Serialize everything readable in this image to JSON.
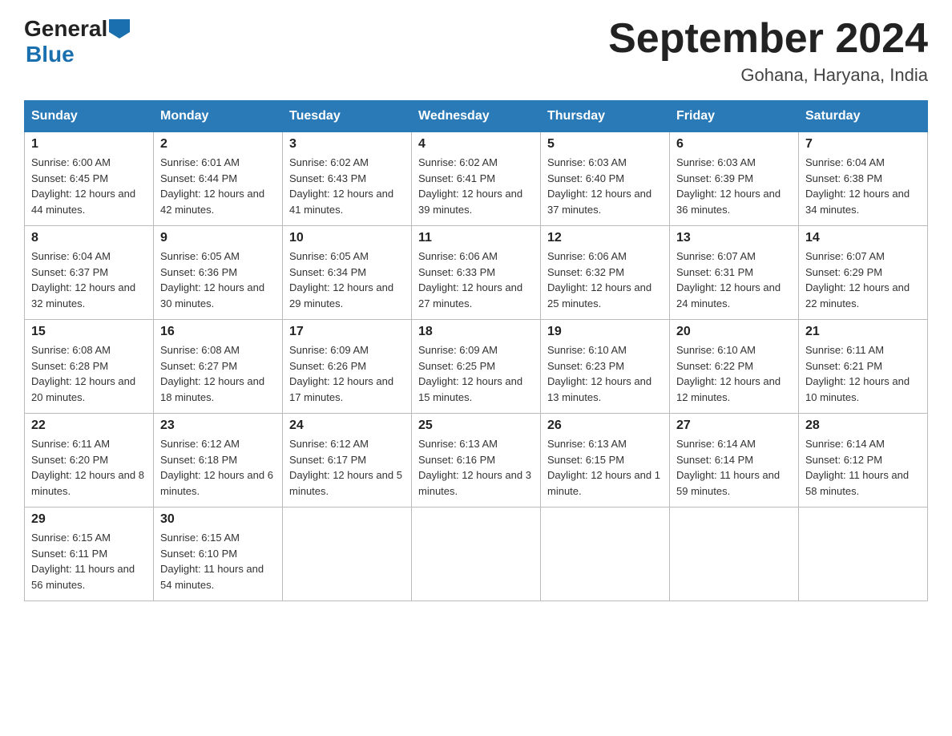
{
  "header": {
    "logo_general": "General",
    "logo_blue": "Blue",
    "month_title": "September 2024",
    "location": "Gohana, Haryana, India"
  },
  "days_of_week": [
    "Sunday",
    "Monday",
    "Tuesday",
    "Wednesday",
    "Thursday",
    "Friday",
    "Saturday"
  ],
  "weeks": [
    [
      {
        "day": "1",
        "sunrise": "6:00 AM",
        "sunset": "6:45 PM",
        "daylight": "12 hours and 44 minutes."
      },
      {
        "day": "2",
        "sunrise": "6:01 AM",
        "sunset": "6:44 PM",
        "daylight": "12 hours and 42 minutes."
      },
      {
        "day": "3",
        "sunrise": "6:02 AM",
        "sunset": "6:43 PM",
        "daylight": "12 hours and 41 minutes."
      },
      {
        "day": "4",
        "sunrise": "6:02 AM",
        "sunset": "6:41 PM",
        "daylight": "12 hours and 39 minutes."
      },
      {
        "day": "5",
        "sunrise": "6:03 AM",
        "sunset": "6:40 PM",
        "daylight": "12 hours and 37 minutes."
      },
      {
        "day": "6",
        "sunrise": "6:03 AM",
        "sunset": "6:39 PM",
        "daylight": "12 hours and 36 minutes."
      },
      {
        "day": "7",
        "sunrise": "6:04 AM",
        "sunset": "6:38 PM",
        "daylight": "12 hours and 34 minutes."
      }
    ],
    [
      {
        "day": "8",
        "sunrise": "6:04 AM",
        "sunset": "6:37 PM",
        "daylight": "12 hours and 32 minutes."
      },
      {
        "day": "9",
        "sunrise": "6:05 AM",
        "sunset": "6:36 PM",
        "daylight": "12 hours and 30 minutes."
      },
      {
        "day": "10",
        "sunrise": "6:05 AM",
        "sunset": "6:34 PM",
        "daylight": "12 hours and 29 minutes."
      },
      {
        "day": "11",
        "sunrise": "6:06 AM",
        "sunset": "6:33 PM",
        "daylight": "12 hours and 27 minutes."
      },
      {
        "day": "12",
        "sunrise": "6:06 AM",
        "sunset": "6:32 PM",
        "daylight": "12 hours and 25 minutes."
      },
      {
        "day": "13",
        "sunrise": "6:07 AM",
        "sunset": "6:31 PM",
        "daylight": "12 hours and 24 minutes."
      },
      {
        "day": "14",
        "sunrise": "6:07 AM",
        "sunset": "6:29 PM",
        "daylight": "12 hours and 22 minutes."
      }
    ],
    [
      {
        "day": "15",
        "sunrise": "6:08 AM",
        "sunset": "6:28 PM",
        "daylight": "12 hours and 20 minutes."
      },
      {
        "day": "16",
        "sunrise": "6:08 AM",
        "sunset": "6:27 PM",
        "daylight": "12 hours and 18 minutes."
      },
      {
        "day": "17",
        "sunrise": "6:09 AM",
        "sunset": "6:26 PM",
        "daylight": "12 hours and 17 minutes."
      },
      {
        "day": "18",
        "sunrise": "6:09 AM",
        "sunset": "6:25 PM",
        "daylight": "12 hours and 15 minutes."
      },
      {
        "day": "19",
        "sunrise": "6:10 AM",
        "sunset": "6:23 PM",
        "daylight": "12 hours and 13 minutes."
      },
      {
        "day": "20",
        "sunrise": "6:10 AM",
        "sunset": "6:22 PM",
        "daylight": "12 hours and 12 minutes."
      },
      {
        "day": "21",
        "sunrise": "6:11 AM",
        "sunset": "6:21 PM",
        "daylight": "12 hours and 10 minutes."
      }
    ],
    [
      {
        "day": "22",
        "sunrise": "6:11 AM",
        "sunset": "6:20 PM",
        "daylight": "12 hours and 8 minutes."
      },
      {
        "day": "23",
        "sunrise": "6:12 AM",
        "sunset": "6:18 PM",
        "daylight": "12 hours and 6 minutes."
      },
      {
        "day": "24",
        "sunrise": "6:12 AM",
        "sunset": "6:17 PM",
        "daylight": "12 hours and 5 minutes."
      },
      {
        "day": "25",
        "sunrise": "6:13 AM",
        "sunset": "6:16 PM",
        "daylight": "12 hours and 3 minutes."
      },
      {
        "day": "26",
        "sunrise": "6:13 AM",
        "sunset": "6:15 PM",
        "daylight": "12 hours and 1 minute."
      },
      {
        "day": "27",
        "sunrise": "6:14 AM",
        "sunset": "6:14 PM",
        "daylight": "11 hours and 59 minutes."
      },
      {
        "day": "28",
        "sunrise": "6:14 AM",
        "sunset": "6:12 PM",
        "daylight": "11 hours and 58 minutes."
      }
    ],
    [
      {
        "day": "29",
        "sunrise": "6:15 AM",
        "sunset": "6:11 PM",
        "daylight": "11 hours and 56 minutes."
      },
      {
        "day": "30",
        "sunrise": "6:15 AM",
        "sunset": "6:10 PM",
        "daylight": "11 hours and 54 minutes."
      },
      null,
      null,
      null,
      null,
      null
    ]
  ]
}
